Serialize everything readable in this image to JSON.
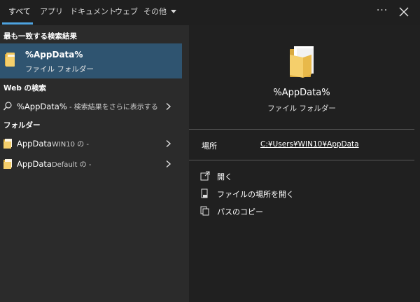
{
  "tabs": [
    {
      "label": "すべて",
      "active": true
    },
    {
      "label": "アプリ"
    },
    {
      "label": "ドキュメント"
    },
    {
      "label": "ウェブ"
    },
    {
      "label": "その他"
    }
  ],
  "header": {
    "more_label": "···"
  },
  "left": {
    "best_match_heading": "最も一致する検索結果",
    "best_match": {
      "title": "%AppData%",
      "subtitle": "ファイル フォルダー"
    },
    "web_heading": "Web の検索",
    "web_result": {
      "query": "%AppData%",
      "suffix": " - 検索結果をさらに表示する"
    },
    "folders_heading": "フォルダー",
    "folders": [
      {
        "name": "AppData",
        "owner": "WIN10",
        "suffix": " の -"
      },
      {
        "name": "AppData",
        "owner": "Default",
        "suffix": " の -"
      }
    ]
  },
  "preview": {
    "title": "%AppData%",
    "subtitle": "ファイル フォルダー",
    "location_label": "場所",
    "location_value": "C:¥Users¥WIN10¥AppData",
    "actions": [
      {
        "label": "開く",
        "icon": "open-icon"
      },
      {
        "label": "ファイルの場所を開く",
        "icon": "file-location-icon"
      },
      {
        "label": "パスのコピー",
        "icon": "copy-icon"
      }
    ]
  },
  "colors": {
    "background": "#2b2b2b",
    "topbar": "#1f1f1f",
    "preview": "#202020",
    "selection": "#2f5470",
    "accent": "#4ea3e0",
    "folder": "#f1c75c"
  }
}
